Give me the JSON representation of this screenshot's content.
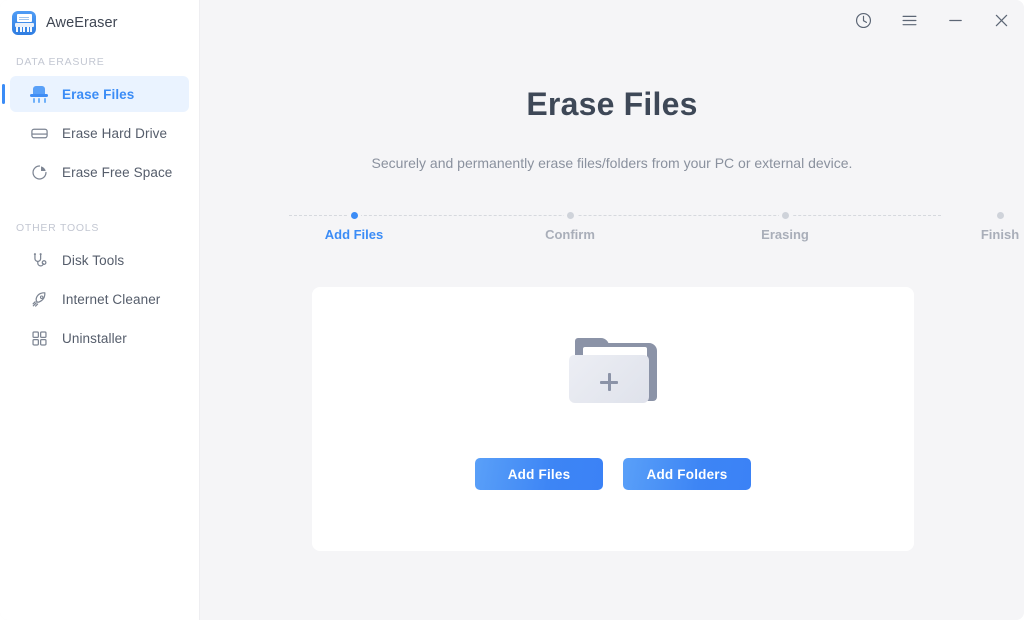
{
  "app": {
    "name": "AweEraser",
    "icon": "shredder-icon"
  },
  "titlebar": {
    "history_icon": "clock-history-icon",
    "menu_icon": "hamburger-menu-icon",
    "minimize_icon": "minimize-icon",
    "close_icon": "close-icon"
  },
  "sidebar": {
    "sections": [
      {
        "label": "DATA ERASURE",
        "items": [
          {
            "label": "Erase Files",
            "icon": "shredder-icon",
            "active": true
          },
          {
            "label": "Erase Hard Drive",
            "icon": "hard-drive-icon",
            "active": false
          },
          {
            "label": "Erase Free Space",
            "icon": "pie-chart-icon",
            "active": false
          }
        ]
      },
      {
        "label": "OTHER TOOLS",
        "items": [
          {
            "label": "Disk Tools",
            "icon": "stethoscope-icon",
            "active": false
          },
          {
            "label": "Internet Cleaner",
            "icon": "rocket-icon",
            "active": false
          },
          {
            "label": "Uninstaller",
            "icon": "grid-squares-icon",
            "active": false
          }
        ]
      }
    ]
  },
  "main": {
    "title": "Erase Files",
    "subtitle": "Securely and permanently erase files/folders from your PC or external device.",
    "steps": [
      {
        "label": "Add Files",
        "active": true
      },
      {
        "label": "Confirm",
        "active": false
      },
      {
        "label": "Erasing",
        "active": false
      },
      {
        "label": "Finish",
        "active": false
      }
    ],
    "dropzone": {
      "icon": "add-folder-icon",
      "add_files_label": "Add Files",
      "add_folders_label": "Add Folders"
    }
  },
  "colors": {
    "accent": "#3b8cf6",
    "accent_light": "#eaf3ff",
    "main_bg": "#f5f5f7",
    "sidebar_bg": "#ffffff",
    "title_text": "#3e4857",
    "muted_text": "#8a919e",
    "step_inactive": "#a9aeb9"
  }
}
